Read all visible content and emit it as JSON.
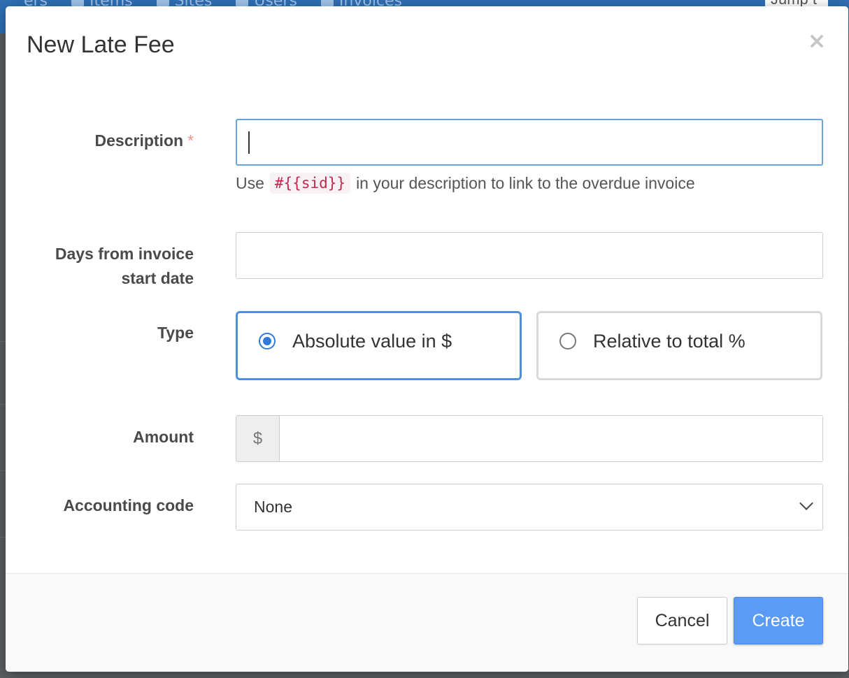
{
  "background": {
    "nav_items": [
      "ers",
      "Items",
      "Sites",
      "Users",
      "Invoices"
    ],
    "jump_text": "Jump t"
  },
  "modal": {
    "title": "New Late Fee",
    "close_symbol": "×"
  },
  "form": {
    "description": {
      "label": "Description",
      "required_mark": "*",
      "value": "",
      "help_prefix": "Use",
      "help_code": "#{{sid}}",
      "help_suffix": "in your description to link to the overdue invoice"
    },
    "days": {
      "label_line1": "Days from invoice",
      "label_line2": "start date",
      "value": ""
    },
    "type": {
      "label": "Type",
      "options": [
        {
          "label": "Absolute value in $",
          "selected": true
        },
        {
          "label": "Relative to total %",
          "selected": false
        }
      ]
    },
    "amount": {
      "label": "Amount",
      "addon": "$",
      "value": ""
    },
    "accounting_code": {
      "label": "Accounting code",
      "selected": "None"
    }
  },
  "footer": {
    "cancel_label": "Cancel",
    "create_label": "Create"
  },
  "colors": {
    "primary": "#5b9bf5",
    "focus_border": "#66a3e0",
    "required": "#f1948a",
    "code_text": "#c7254e"
  }
}
